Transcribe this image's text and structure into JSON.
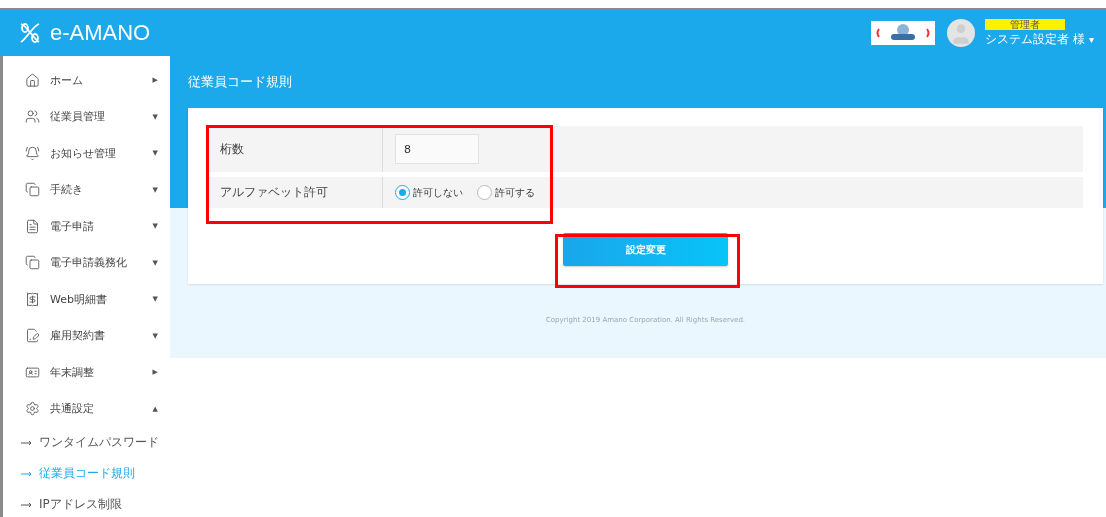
{
  "header": {
    "logo": "e-AMANO",
    "role_badge": "管理者",
    "user_name": "システム設定者 様",
    "user_caret": "▾"
  },
  "sidebar": {
    "items": [
      {
        "label": "ホーム",
        "caret": "▶"
      },
      {
        "label": "従業員管理",
        "caret": "▼"
      },
      {
        "label": "お知らせ管理",
        "caret": "▼"
      },
      {
        "label": "手続き",
        "caret": "▼"
      },
      {
        "label": "電子申請",
        "caret": "▼"
      },
      {
        "label": "電子申請義務化",
        "caret": "▼"
      },
      {
        "label": "Web明細書",
        "caret": "▼"
      },
      {
        "label": "雇用契約書",
        "caret": "▼"
      },
      {
        "label": "年末調整",
        "caret": "▶"
      },
      {
        "label": "共通設定",
        "caret": "▲",
        "children": [
          {
            "label": "ワンタイムパスワード",
            "selected": false
          },
          {
            "label": "従業員コード規則",
            "selected": true
          },
          {
            "label": "IPアドレス制限",
            "selected": false
          }
        ]
      }
    ]
  },
  "page": {
    "title": "従業員コード規則",
    "form": {
      "rows": [
        {
          "kind": "input",
          "label": "桁数",
          "value": "8"
        },
        {
          "kind": "radio",
          "label": "アルファベット許可",
          "options": [
            {
              "label": "許可しない",
              "selected": true
            },
            {
              "label": "許可する",
              "selected": false
            }
          ]
        }
      ],
      "submit": "設定変更"
    },
    "footer": "Copyright 2019 Amano Corporation. All Rights Reserved."
  }
}
